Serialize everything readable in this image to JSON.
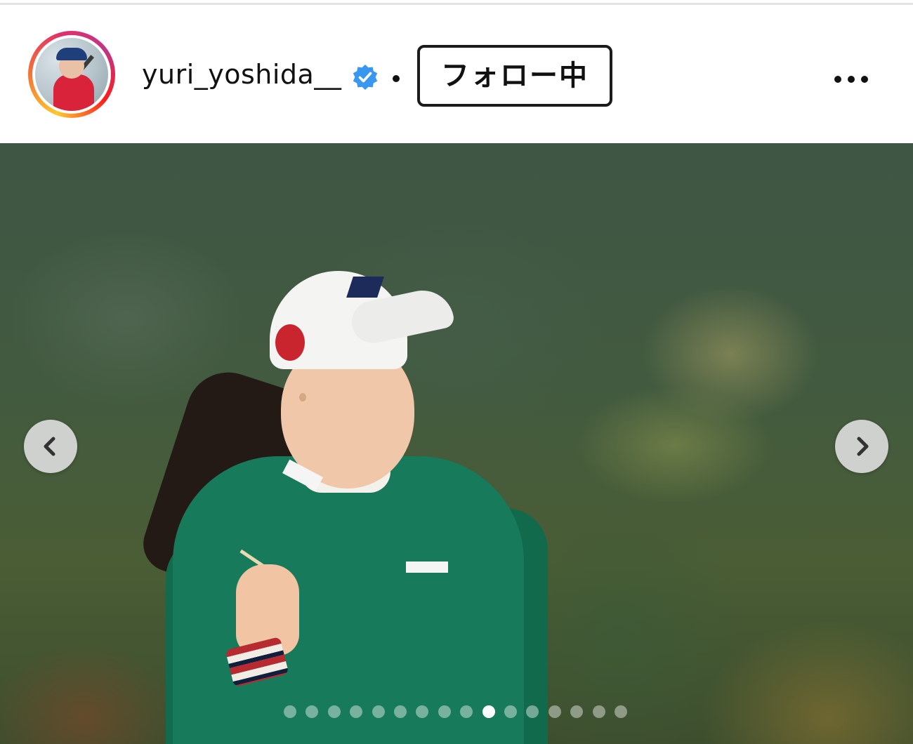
{
  "post_header": {
    "username": "yuri_yoshida__",
    "verified": true,
    "separator": "•",
    "follow_button_label": "フォロー中",
    "more_menu": "more-options-icon"
  },
  "avatar": {
    "story_ring": true,
    "ring_colors": [
      "#fdc830",
      "#f37335",
      "#e1306c",
      "#c13584"
    ]
  },
  "carousel": {
    "prev_icon": "chevron-left-icon",
    "next_icon": "chevron-right-icon",
    "total_slides": 16,
    "current_slide": 10
  },
  "colors": {
    "verified_badge": "#3897f0",
    "text": "#111111"
  }
}
